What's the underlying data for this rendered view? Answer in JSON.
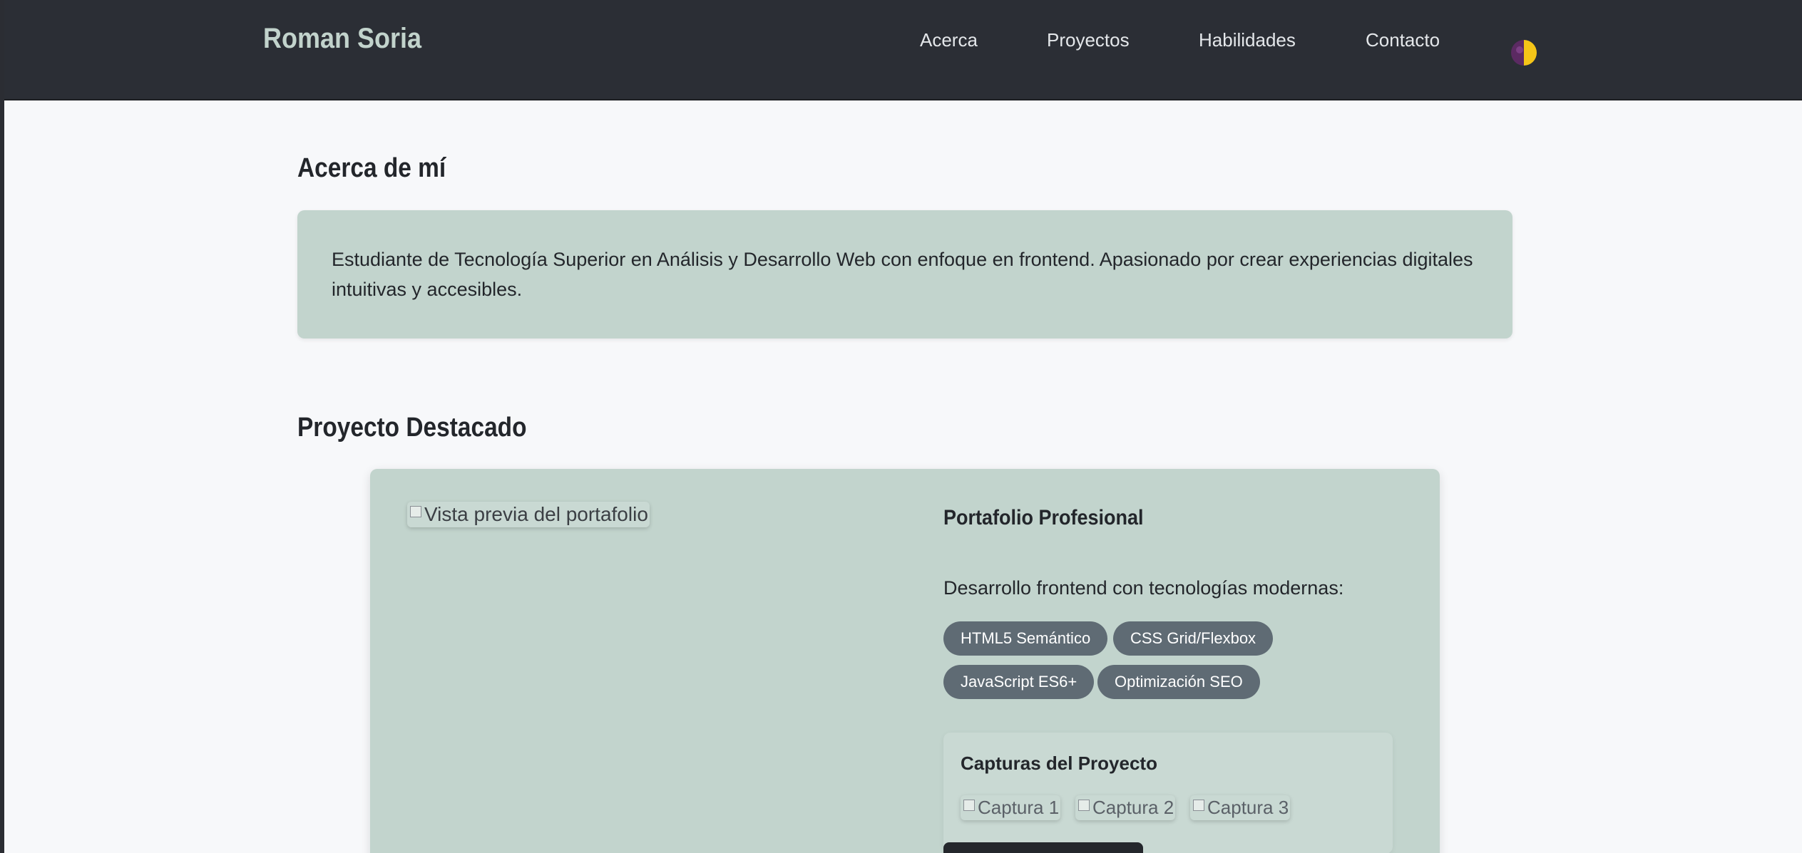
{
  "header": {
    "brand": "Roman Soria",
    "nav": [
      "Acerca",
      "Proyectos",
      "Habilidades",
      "Contacto"
    ],
    "theme_toggle_icon": "half-moon-sun-icon"
  },
  "about": {
    "title": "Acerca de mí",
    "text": "Estudiante de Tecnología Superior en Análisis y Desarrollo Web con enfoque en frontend. Apasionado por crear experiencias digitales intuitivas y accesibles."
  },
  "project": {
    "section_title": "Proyecto Destacado",
    "preview_alt": "Vista previa del portafolio",
    "name": "Portafolio Profesional",
    "description": "Desarrollo frontend con tecnologías modernas:",
    "tags": [
      "HTML5 Semántico",
      "CSS Grid/Flexbox",
      "JavaScript ES6+",
      "Optimización SEO"
    ],
    "screens": {
      "title": "Capturas del Proyecto",
      "alts": [
        "Captura 1",
        "Captura 2",
        "Captura 3"
      ]
    }
  },
  "colors": {
    "navbar": "#2b2e35",
    "page_bg": "#f7f8fa",
    "card_bg": "#c2d4cd",
    "tag_bg": "#5f6b74",
    "brand": "#c2d3cc"
  }
}
